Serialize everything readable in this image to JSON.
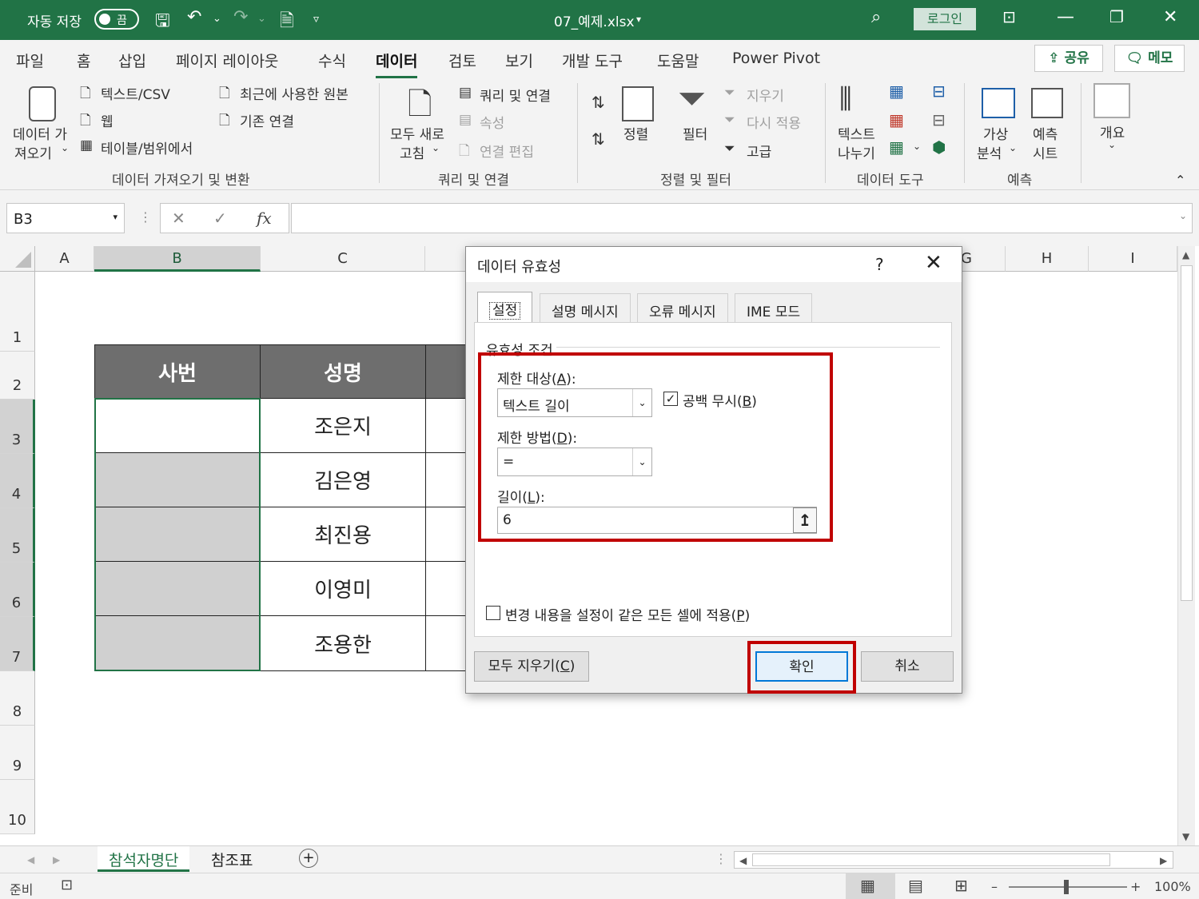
{
  "titlebar": {
    "autosave_label": "자동 저장",
    "autosave_state": "끔",
    "filename": "07_예제.xlsx",
    "login_label": "로그인"
  },
  "ribbon_tabs": [
    "파일",
    "홈",
    "삽입",
    "페이지 레이아웃",
    "수식",
    "데이터",
    "검토",
    "보기",
    "개발 도구",
    "도움말",
    "Power Pivot"
  ],
  "active_tab": "데이터",
  "share_label": "공유",
  "memo_label": "메모",
  "ribbon": {
    "get_data": [
      "데이터 가",
      "져오기"
    ],
    "text_csv": "텍스트/CSV",
    "web": "웹",
    "from_table": "테이블/범위에서",
    "recent_sources": "최근에 사용한 원본",
    "existing_conn": "기존 연결",
    "group_get": "데이터 가져오기 및 변환",
    "refresh_all": [
      "모두 새로",
      "고침"
    ],
    "queries_conn": "쿼리 및 연결",
    "properties": "속성",
    "edit_links": "연결 편집",
    "group_queries": "쿼리 및 연결",
    "sort": "정렬",
    "filter": "필터",
    "clear": "지우기",
    "reapply": "다시 적용",
    "advanced": "고급",
    "group_sort": "정렬 및 필터",
    "text_to_cols": [
      "텍스트",
      "나누기"
    ],
    "group_tools": "데이터 도구",
    "what_if": [
      "가상",
      "분석"
    ],
    "forecast_sheet": [
      "예측",
      "시트"
    ],
    "group_forecast": "예측",
    "outline": "개요"
  },
  "formula_bar": {
    "name_box": "B3",
    "fx": "fx"
  },
  "columns": [
    "A",
    "B",
    "C",
    "G",
    "H",
    "I"
  ],
  "rows": [
    "1",
    "2",
    "3",
    "4",
    "5",
    "6",
    "7",
    "8",
    "9",
    "10"
  ],
  "table": {
    "headers": [
      "사번",
      "성명"
    ],
    "names": [
      "조은지",
      "김은영",
      "최진용",
      "이영미",
      "조용한"
    ]
  },
  "sheets": [
    "참석자명단",
    "참조표"
  ],
  "status": {
    "ready": "준비",
    "zoom": "100%"
  },
  "dialog": {
    "title": "데이터 유효성",
    "help": "?",
    "close": "✕",
    "tabs": [
      "설정",
      "설명 메시지",
      "오류 메시지",
      "IME 모드"
    ],
    "criteria_legend": "유효성 조건",
    "allow_label": "제한 대상(",
    "allow_key": "A",
    "allow_value": "텍스트 길이",
    "ignore_blank_label": "공백 무시(",
    "ignore_blank_key": "B",
    "ignore_blank_checked": true,
    "data_label": "제한 방법(",
    "data_key": "D",
    "data_value": "=",
    "length_label": "길이(",
    "length_key": "L",
    "length_value": "6",
    "apply_all_label": "변경 내용을 설정이 같은 모든 셀에 적용(",
    "apply_all_key": "P",
    "clear_all": "모두 지우기(",
    "clear_all_key": "C",
    "ok": "확인",
    "cancel": "취소"
  }
}
